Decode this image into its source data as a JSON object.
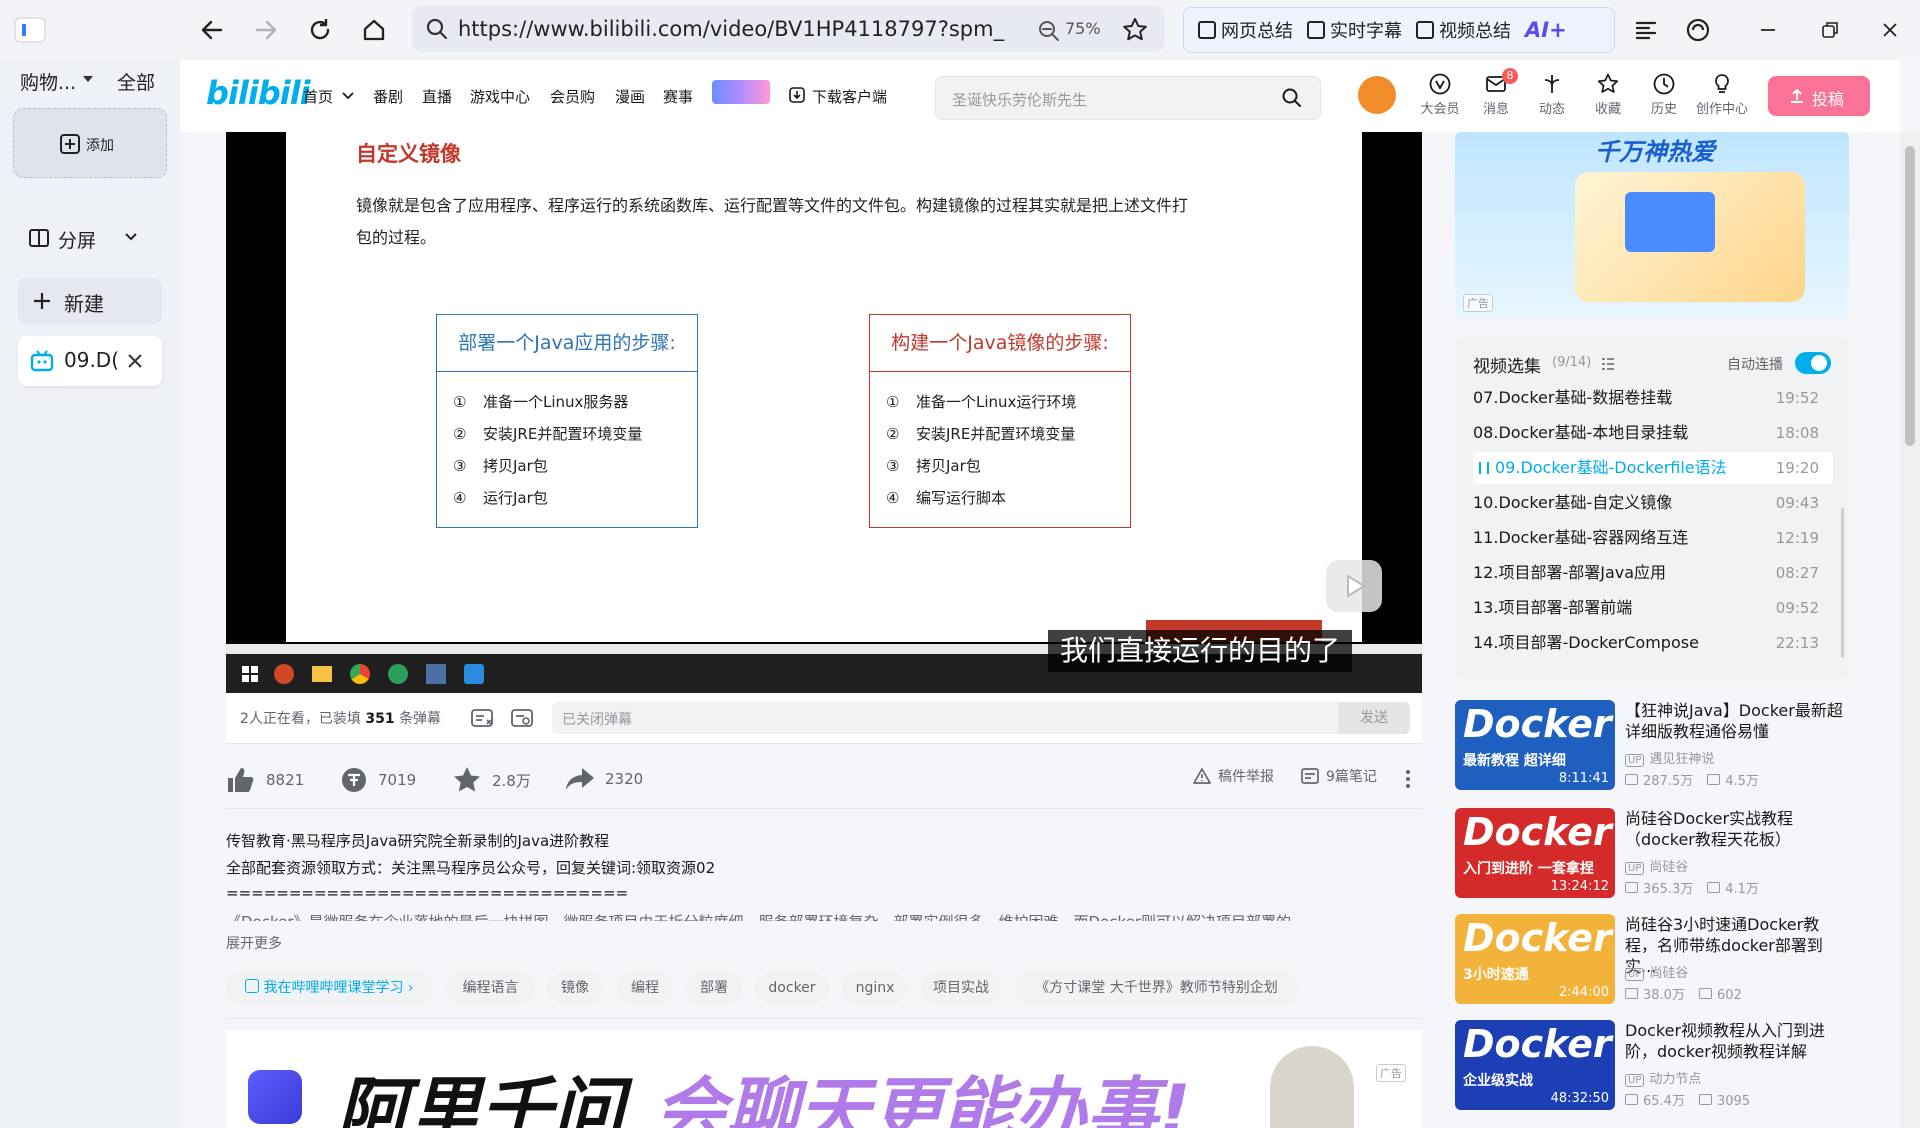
{
  "browser": {
    "app_name": "购物...",
    "all_label": "全部",
    "url": "https://www.bilibili.com/video/BV1HP4118797?spm_",
    "zoom": "75%",
    "ai_tools": [
      "网页总结",
      "实时字幕",
      "视频总结"
    ],
    "ai_label": "AI+",
    "add_label": "添加",
    "split_label": "分屏",
    "new_label": "新建",
    "tab_title": "09.D("
  },
  "header": {
    "logo": "bilibili",
    "nav": [
      "首页",
      "番剧",
      "直播",
      "游戏中心",
      "会员购",
      "漫画",
      "赛事",
      "下载客户端"
    ],
    "search_placeholder": "圣诞快乐劳伦斯先生",
    "message_badge": "8",
    "icons": [
      "大会员",
      "消息",
      "动态",
      "收藏",
      "历史",
      "创作中心"
    ],
    "upload_label": "投稿"
  },
  "video": {
    "slide_title": "自定义镜像",
    "slide_body_1": "镜像就是包含了应用程序、程序运行的系统函数库、运行配置等文件的文件包。构建镜像的过程其实就是把上述文件打",
    "slide_body_2": "包的过程。",
    "left_box": {
      "title": "部署一个Java应用的步骤:",
      "steps": [
        "①",
        "准备一个Linux服务器",
        "②",
        "安装JRE并配置环境变量",
        "③",
        "拷贝Jar包",
        "④",
        "运行Jar包"
      ]
    },
    "right_box": {
      "title": "构建一个Java镜像的步骤:",
      "steps": [
        "①",
        "准备一个Linux运行环境",
        "②",
        "安装JRE并配置环境变量",
        "③",
        "拷贝Jar包",
        "④",
        "编写运行脚本"
      ]
    },
    "subtitle": "我们直接运行的目的了"
  },
  "danmaku": {
    "viewers": "2人正在看，已装填",
    "count": "351",
    "suffix": "条弹幕",
    "placeholder": "已关闭弹幕",
    "send": "发送"
  },
  "actions": {
    "like": "8821",
    "coin": "7019",
    "favorite": "2.8万",
    "share": "2320",
    "report": "稿件举报",
    "notes": "9篇笔记"
  },
  "description": {
    "line1": "传智教育·黑马程序员Java研究院全新录制的Java进阶教程",
    "line2": "全部配套资源领取方式：关注黑马程序员公众号，回复关键词:领取资源02",
    "line3": "================================",
    "line4": "《Docker》是微服务在企业落地的最后一块拼图，微服务项目由于拆分粒度细，服务部署环境复杂，部署实例很多，维护困难。而Docker则可以解决项目部署的",
    "expand": "展开更多"
  },
  "tags": [
    "我在哔哩哔哩课堂学习",
    "编程语言",
    "镜像",
    "编程",
    "部署",
    "docker",
    "nginx",
    "项目实战",
    "《方寸课堂 大千世界》教师节特别企划"
  ],
  "ad": {
    "text1": "阿里千问",
    "text2": "会聊天更能办事!",
    "label": "广告"
  },
  "right_ad": {
    "text": "千万神热爱",
    "label": "广告"
  },
  "playlist": {
    "title": "视频选集",
    "progress": "(9/14)",
    "autoplay": "自动连播",
    "autoplay_on": true,
    "items": [
      {
        "title": "07.Docker基础-数据卷挂载",
        "duration": "19:52"
      },
      {
        "title": "08.Docker基础-本地目录挂载",
        "duration": "18:08"
      },
      {
        "title": "09.Docker基础-Dockerfile语法",
        "duration": "19:20"
      },
      {
        "title": "10.Docker基础-自定义镜像",
        "duration": "09:43"
      },
      {
        "title": "11.Docker基础-容器网络互连",
        "duration": "12:19"
      },
      {
        "title": "12.项目部署-部署Java应用",
        "duration": "08:27"
      },
      {
        "title": "13.项目部署-部署前端",
        "duration": "09:52"
      },
      {
        "title": "14.项目部署-DockerCompose",
        "duration": "22:13"
      }
    ],
    "active_index": 2
  },
  "recommendations": [
    {
      "title": "【狂神说Java】Docker最新超详细版教程通俗易懂",
      "up": "遇见狂神说",
      "views": "287.5万",
      "danmaku": "4.5万",
      "duration": "8:11:41",
      "thumb_text": "Docker",
      "thumb_sub": "最新教程 超详细",
      "color": "#1f5fbf"
    },
    {
      "title": "尚硅谷Docker实战教程（docker教程天花板）",
      "up": "尚硅谷",
      "views": "365.3万",
      "danmaku": "4.1万",
      "duration": "13:24:12",
      "thumb_text": "Docker",
      "thumb_sub": "入门到进阶 一套拿捏",
      "color": "#d42a2a"
    },
    {
      "title": "尚硅谷3小时速通Docker教程，名师带练docker部署到实...",
      "up": "尚硅谷",
      "views": "38.0万",
      "danmaku": "602",
      "duration": "2:44:00",
      "thumb_text": "Docker",
      "thumb_sub": "3小时速通",
      "color": "#f3b23a"
    },
    {
      "title": "Docker视频教程从入门到进阶，docker视频教程详解",
      "up": "动力节点",
      "views": "65.4万",
      "danmaku": "3095",
      "duration": "48:32:50",
      "thumb_text": "Docker",
      "thumb_sub": "企业级实战",
      "color": "#1d3fb6"
    }
  ],
  "colors": {
    "pink": "#fb7299",
    "blue": "#00aeec",
    "slide_blue": "#2e75b6",
    "slide_red": "#c0392b"
  }
}
